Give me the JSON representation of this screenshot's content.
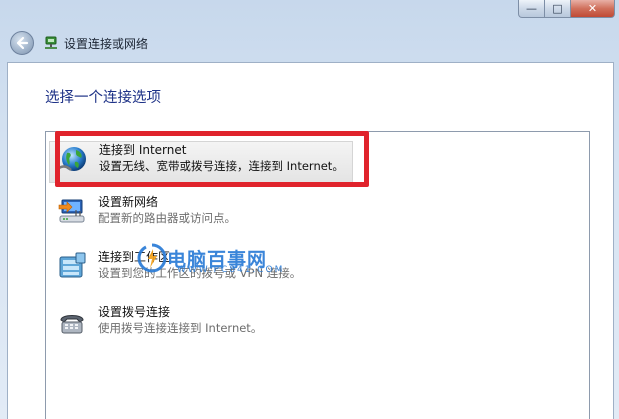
{
  "window": {
    "title": "设置连接或网络",
    "caption": {
      "minimize_glyph": "—",
      "maximize_glyph": "□",
      "close_glyph": "✕"
    }
  },
  "page": {
    "heading": "选择一个连接选项"
  },
  "options": [
    {
      "title": "连接到 Internet",
      "description": "设置无线、宽带或拨号连接，连接到 Internet。",
      "icon": "globe-icon",
      "selected": true
    },
    {
      "title": "设置新网络",
      "description": "配置新的路由器或访问点。",
      "icon": "network-setup-icon",
      "selected": false
    },
    {
      "title": "连接到工作区",
      "description": "设置到您的工作区的拨号或 VPN 连接。",
      "icon": "workplace-icon",
      "selected": false
    },
    {
      "title": "设置拨号连接",
      "description": "使用拨号连接连接到 Internet。",
      "icon": "dialup-phone-icon",
      "selected": false
    }
  ],
  "watermark": {
    "text": "电脑百事网",
    "url": "WWW.PC841.COM"
  },
  "colors": {
    "heading": "#1e3287",
    "highlight": "#e0232c",
    "watermark": "#2a7bd6"
  }
}
